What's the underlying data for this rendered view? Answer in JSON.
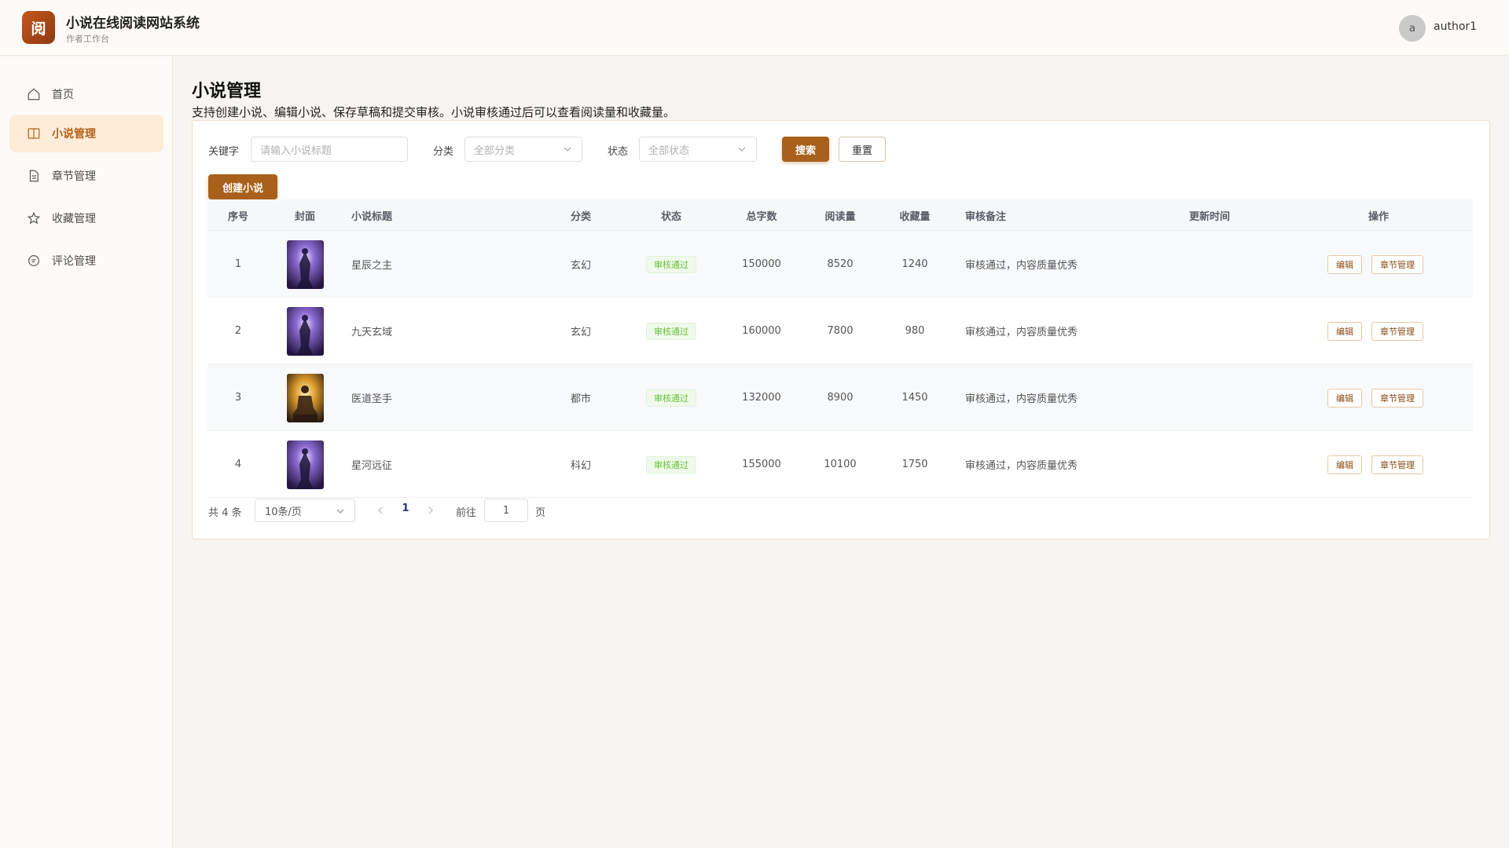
{
  "header": {
    "logo_char": "阅",
    "app_title": "小说在线阅读网站系统",
    "app_subtitle": "作者工作台",
    "avatar_letter": "a",
    "username": "author1"
  },
  "sidebar": {
    "items": [
      {
        "label": "首页",
        "icon": "home-icon",
        "active": false
      },
      {
        "label": "小说管理",
        "icon": "book-icon",
        "active": true
      },
      {
        "label": "章节管理",
        "icon": "document-icon",
        "active": false
      },
      {
        "label": "收藏管理",
        "icon": "star-icon",
        "active": false
      },
      {
        "label": "评论管理",
        "icon": "comment-icon",
        "active": false
      }
    ]
  },
  "main": {
    "title": "小说管理",
    "description": "支持创建小说、编辑小说、保存草稿和提交审核。小说审核通过后可以查看阅读量和收藏量。"
  },
  "filters": {
    "keyword_label": "关键字",
    "keyword_placeholder": "请输入小说标题",
    "category_label": "分类",
    "category_placeholder": "全部分类",
    "status_label": "状态",
    "status_placeholder": "全部状态",
    "search_label": "搜索",
    "reset_label": "重置",
    "create_label": "创建小说"
  },
  "table": {
    "headers": {
      "index": "序号",
      "cover": "封面",
      "title": "小说标题",
      "category": "分类",
      "status": "状态",
      "words": "总字数",
      "reads": "阅读量",
      "favorites": "收藏量",
      "review_note": "审核备注",
      "updated": "更新时间",
      "actions": "操作"
    },
    "edit_label": "编辑",
    "chapter_label": "章节管理",
    "rows": [
      {
        "index": "1",
        "cover": "purple",
        "title": "星辰之主",
        "category": "玄幻",
        "status": "审核通过",
        "words": "150000",
        "reads": "8520",
        "favorites": "1240",
        "review_note": "审核通过，内容质量优秀",
        "updated": ""
      },
      {
        "index": "2",
        "cover": "purple",
        "title": "九天玄域",
        "category": "玄幻",
        "status": "审核通过",
        "words": "160000",
        "reads": "7800",
        "favorites": "980",
        "review_note": "审核通过，内容质量优秀",
        "updated": ""
      },
      {
        "index": "3",
        "cover": "gold",
        "title": "医道圣手",
        "category": "都市",
        "status": "审核通过",
        "words": "132000",
        "reads": "8900",
        "favorites": "1450",
        "review_note": "审核通过，内容质量优秀",
        "updated": ""
      },
      {
        "index": "4",
        "cover": "purple",
        "title": "星河远征",
        "category": "科幻",
        "status": "审核通过",
        "words": "155000",
        "reads": "10100",
        "favorites": "1750",
        "review_note": "审核通过，内容质量优秀",
        "updated": ""
      }
    ]
  },
  "pagination": {
    "total_text": "共 4 条",
    "page_size": "10条/页",
    "current_page": "1",
    "goto_prefix": "前往",
    "goto_value": "1",
    "goto_suffix": "页"
  },
  "colors": {
    "accent": "#a8601b",
    "active_bg": "#fcecd8",
    "success": "#67c23a"
  }
}
